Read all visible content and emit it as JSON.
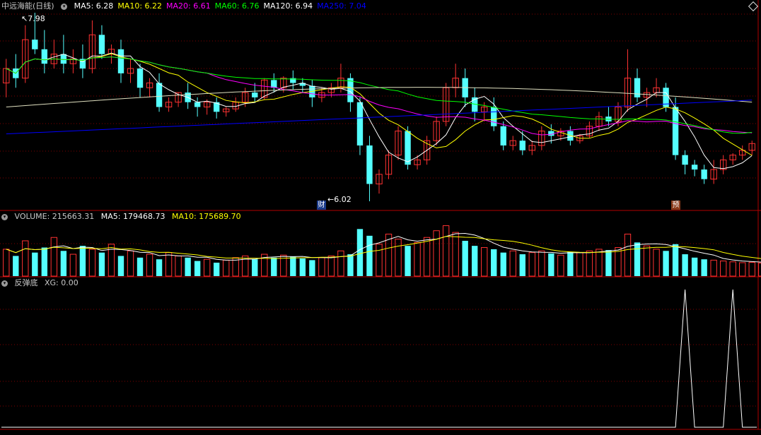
{
  "header": {
    "stock_title": "中远海能(日线)",
    "ma": [
      {
        "label": "MA5: 6.28",
        "color": "#ffffff"
      },
      {
        "label": "MA10: 6.22",
        "color": "#ffff00"
      },
      {
        "label": "MA20: 6.61",
        "color": "#ff00ff"
      },
      {
        "label": "MA60: 6.76",
        "color": "#00ff00"
      },
      {
        "label": "MA120: 6.94",
        "color": "#ffffff"
      },
      {
        "label": "MA250: 7.04",
        "color": "#0000ff"
      }
    ]
  },
  "volume_header": {
    "title": "VOLUME: 215663.31",
    "ma5": "MA5: 179468.73",
    "ma10": "MA10: 175689.70"
  },
  "indicator_header": {
    "title": "反弹底",
    "xg": "XG: 0.00"
  },
  "annotations": {
    "high_label": "7.98",
    "low_label": "6.02",
    "marker_cai": "财",
    "marker_yu": "预"
  },
  "colors": {
    "up": "#ff3232",
    "down": "#54ffff",
    "ma5": "#ffffff",
    "ma10": "#ffff00",
    "ma20": "#ff00ff",
    "ma60": "#00ff00",
    "ma120": "#ffffff",
    "ma250": "#0000ff",
    "panel_border": "#b00000",
    "grid": "#800000"
  },
  "chart_data": [
    {
      "type": "candlestick",
      "panel": "price",
      "price_high": 7.98,
      "price_low": 6.02,
      "series": [
        {
          "name": "MA5",
          "last": 6.28
        },
        {
          "name": "MA10",
          "last": 6.22
        },
        {
          "name": "MA20",
          "last": 6.61
        },
        {
          "name": "MA60",
          "last": 6.76
        },
        {
          "name": "MA120",
          "last": 6.94
        },
        {
          "name": "MA250",
          "last": 7.04
        }
      ],
      "ohlc": [
        [
          7.25,
          7.5,
          7.4,
          7.1
        ],
        [
          7.4,
          7.55,
          7.3,
          7.2
        ],
        [
          7.3,
          7.85,
          7.7,
          7.25
        ],
        [
          7.7,
          7.98,
          7.6,
          7.55
        ],
        [
          7.6,
          7.8,
          7.45,
          7.35
        ],
        [
          7.45,
          7.7,
          7.55,
          7.4
        ],
        [
          7.55,
          7.75,
          7.45,
          7.35
        ],
        [
          7.45,
          7.6,
          7.5,
          7.35
        ],
        [
          7.5,
          7.65,
          7.4,
          7.3
        ],
        [
          7.4,
          7.9,
          7.75,
          7.35
        ],
        [
          7.75,
          7.85,
          7.55,
          7.5
        ],
        [
          7.55,
          7.65,
          7.6,
          7.45
        ],
        [
          7.6,
          7.7,
          7.35,
          7.25
        ],
        [
          7.35,
          7.5,
          7.4,
          7.25
        ],
        [
          7.4,
          7.45,
          7.2,
          7.1
        ],
        [
          7.2,
          7.3,
          7.25,
          7.1
        ],
        [
          7.25,
          7.35,
          7.0,
          6.95
        ],
        [
          7.0,
          7.1,
          7.05,
          6.95
        ],
        [
          7.05,
          7.15,
          7.15,
          7.0
        ],
        [
          7.15,
          7.25,
          7.05,
          6.98
        ],
        [
          7.05,
          7.1,
          7.0,
          6.9
        ],
        [
          7.0,
          7.08,
          7.05,
          6.92
        ],
        [
          7.05,
          7.1,
          6.95,
          6.88
        ],
        [
          6.95,
          7.0,
          6.98,
          6.9
        ],
        [
          6.98,
          7.1,
          7.05,
          6.95
        ],
        [
          7.05,
          7.2,
          7.15,
          7.0
        ],
        [
          7.15,
          7.25,
          7.1,
          7.05
        ],
        [
          7.1,
          7.3,
          7.28,
          7.08
        ],
        [
          7.28,
          7.35,
          7.2,
          7.15
        ],
        [
          7.2,
          7.32,
          7.3,
          7.15
        ],
        [
          7.3,
          7.38,
          7.25,
          7.18
        ],
        [
          7.25,
          7.3,
          7.22,
          7.15
        ],
        [
          7.22,
          7.28,
          7.1,
          7.0
        ],
        [
          7.1,
          7.2,
          7.15,
          7.05
        ],
        [
          7.15,
          7.25,
          7.2,
          7.1
        ],
        [
          7.2,
          7.45,
          7.3,
          7.15
        ],
        [
          7.3,
          7.35,
          7.05,
          6.95
        ],
        [
          7.05,
          7.1,
          6.6,
          6.5
        ],
        [
          6.6,
          6.7,
          6.2,
          6.02
        ],
        [
          6.2,
          6.35,
          6.3,
          6.1
        ],
        [
          6.3,
          6.55,
          6.5,
          6.25
        ],
        [
          6.5,
          6.8,
          6.75,
          6.45
        ],
        [
          6.75,
          6.8,
          6.4,
          6.35
        ],
        [
          6.4,
          6.5,
          6.45,
          6.35
        ],
        [
          6.45,
          6.7,
          6.65,
          6.4
        ],
        [
          6.65,
          6.9,
          6.85,
          6.6
        ],
        [
          6.85,
          7.25,
          7.2,
          6.8
        ],
        [
          7.2,
          7.45,
          7.3,
          7.1
        ],
        [
          7.3,
          7.4,
          7.1,
          7.0
        ],
        [
          7.1,
          7.2,
          6.95,
          6.85
        ],
        [
          6.95,
          7.05,
          7.0,
          6.85
        ],
        [
          7.0,
          7.1,
          6.8,
          6.75
        ],
        [
          6.8,
          6.85,
          6.6,
          6.55
        ],
        [
          6.6,
          6.7,
          6.65,
          6.55
        ],
        [
          6.65,
          6.75,
          6.55,
          6.5
        ],
        [
          6.55,
          6.65,
          6.6,
          6.5
        ],
        [
          6.6,
          6.8,
          6.75,
          6.55
        ],
        [
          6.75,
          6.82,
          6.7,
          6.62
        ],
        [
          6.7,
          6.78,
          6.75,
          6.65
        ],
        [
          6.75,
          6.8,
          6.65,
          6.6
        ],
        [
          6.65,
          6.72,
          6.7,
          6.62
        ],
        [
          6.7,
          6.85,
          6.8,
          6.68
        ],
        [
          6.8,
          6.95,
          6.9,
          6.75
        ],
        [
          6.9,
          7.0,
          6.85,
          6.8
        ],
        [
          6.85,
          7.05,
          7.0,
          6.8
        ],
        [
          7.0,
          7.6,
          7.3,
          6.95
        ],
        [
          7.3,
          7.4,
          7.1,
          7.05
        ],
        [
          7.1,
          7.2,
          7.15,
          7.0
        ],
        [
          7.15,
          7.3,
          7.2,
          7.1
        ],
        [
          7.2,
          7.25,
          7.0,
          6.95
        ],
        [
          7.0,
          7.1,
          6.5,
          6.45
        ],
        [
          6.5,
          6.55,
          6.4,
          6.3
        ],
        [
          6.4,
          6.45,
          6.35,
          6.28
        ],
        [
          6.35,
          6.4,
          6.25,
          6.2
        ],
        [
          6.25,
          6.45,
          6.35,
          6.2
        ],
        [
          6.35,
          6.5,
          6.45,
          6.3
        ],
        [
          6.45,
          6.52,
          6.5,
          6.4
        ],
        [
          6.5,
          6.6,
          6.55,
          6.45
        ],
        [
          6.55,
          6.65,
          6.62,
          6.5
        ]
      ]
    },
    {
      "type": "bar",
      "panel": "volume",
      "values": [
        160,
        120,
        210,
        140,
        170,
        230,
        150,
        130,
        180,
        160,
        140,
        190,
        120,
        150,
        110,
        130,
        100,
        140,
        120,
        110,
        90,
        100,
        80,
        95,
        110,
        120,
        100,
        130,
        110,
        125,
        115,
        105,
        95,
        110,
        120,
        150,
        130,
        280,
        240,
        190,
        250,
        220,
        180,
        200,
        230,
        270,
        300,
        260,
        210,
        180,
        170,
        160,
        140,
        150,
        130,
        140,
        150,
        135,
        125,
        145,
        140,
        150,
        160,
        155,
        170,
        250,
        200,
        180,
        160,
        150,
        190,
        130,
        110,
        100,
        95,
        90,
        85,
        80,
        82,
        78
      ],
      "ma5_last": "179468.73",
      "ma10_last": "175689.70"
    },
    {
      "type": "line",
      "panel": "indicator",
      "name": "XG",
      "signal_bars": [
        71,
        76
      ]
    }
  ]
}
